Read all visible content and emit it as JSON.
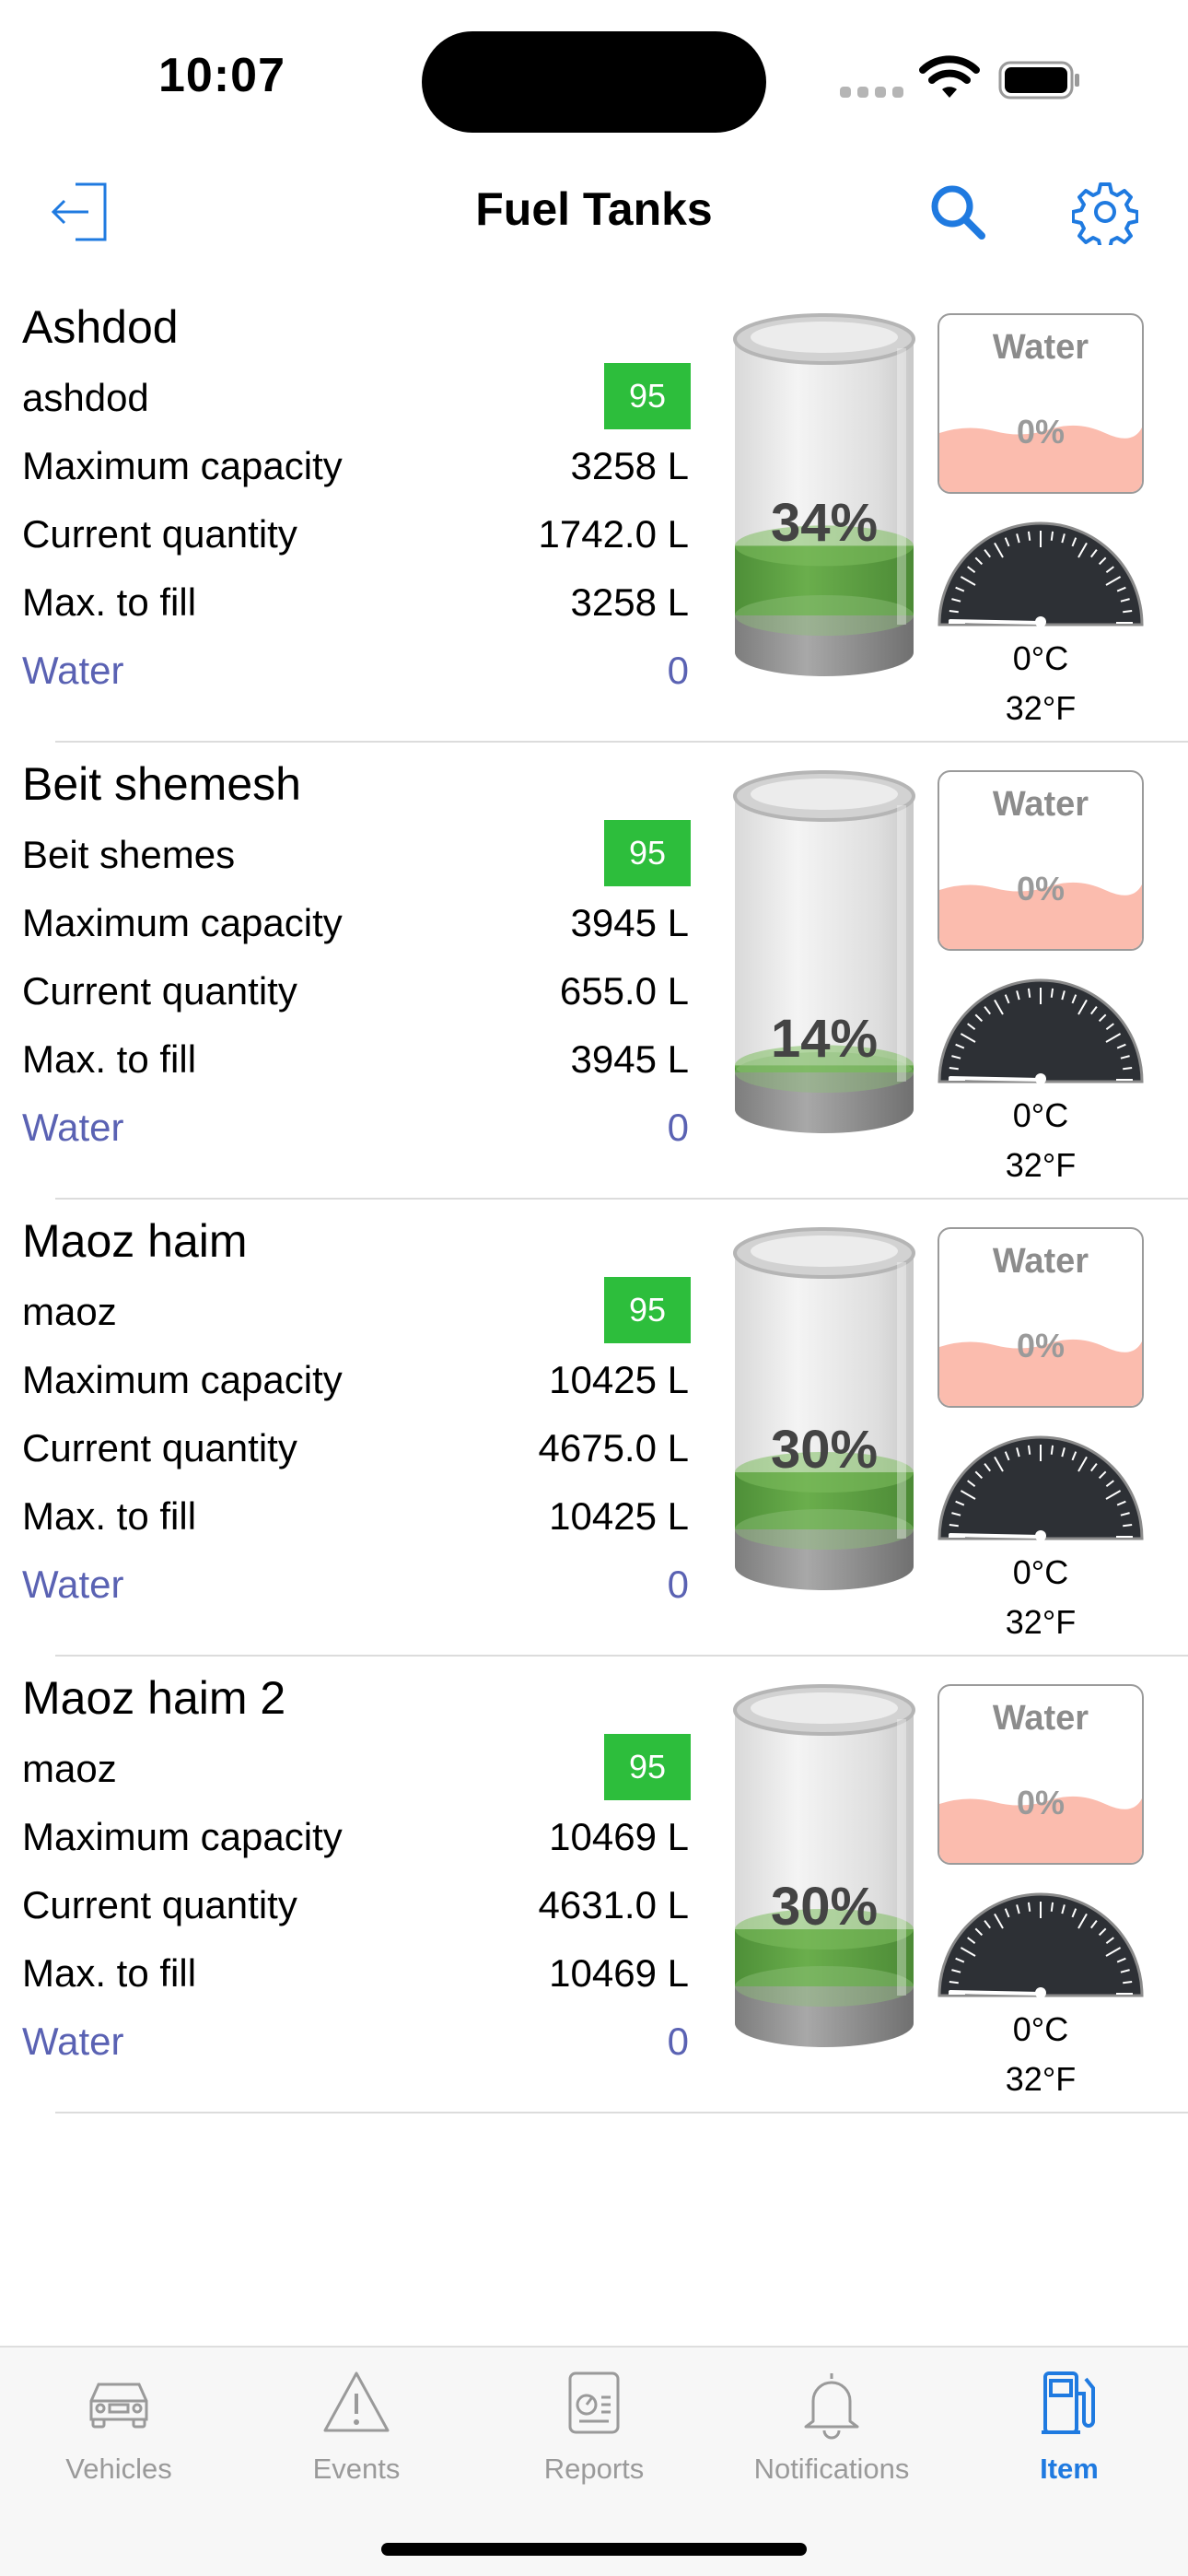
{
  "status": {
    "time": "10:07"
  },
  "nav": {
    "title": "Fuel Tanks"
  },
  "labels": {
    "max_capacity": "Maximum capacity",
    "current_quantity": "Current quantity",
    "max_fill": "Max. to fill",
    "water": "Water"
  },
  "tanks": [
    {
      "name": "Ashdod",
      "sub": "ashdod",
      "fuel": "95",
      "max_capacity": "3258 L",
      "current_quantity": "1742.0 L",
      "max_fill": "3258 L",
      "water_value": "0",
      "fill_pct": "34%",
      "fill_fraction": 0.34,
      "water_box_title": "Water",
      "water_pct": "0%",
      "temp_c": "0°C",
      "temp_f": "32°F"
    },
    {
      "name": "Beit shemesh",
      "sub": "Beit shemes",
      "fuel": "95",
      "max_capacity": "3945 L",
      "current_quantity": "655.0 L",
      "max_fill": "3945 L",
      "water_value": "0",
      "fill_pct": "14%",
      "fill_fraction": 0.14,
      "water_box_title": "Water",
      "water_pct": "0%",
      "temp_c": "0°C",
      "temp_f": "32°F"
    },
    {
      "name": "Maoz haim",
      "sub": "maoz",
      "fuel": "95",
      "max_capacity": "10425 L",
      "current_quantity": "4675.0 L",
      "max_fill": "10425 L",
      "water_value": "0",
      "fill_pct": "30%",
      "fill_fraction": 0.3,
      "water_box_title": "Water",
      "water_pct": "0%",
      "temp_c": "0°C",
      "temp_f": "32°F"
    },
    {
      "name": "Maoz haim 2",
      "sub": "maoz",
      "fuel": "95",
      "max_capacity": "10469 L",
      "current_quantity": "4631.0 L",
      "max_fill": "10469 L",
      "water_value": "0",
      "fill_pct": "30%",
      "fill_fraction": 0.3,
      "water_box_title": "Water",
      "water_pct": "0%",
      "temp_c": "0°C",
      "temp_f": "32°F"
    }
  ],
  "tabs": [
    {
      "label": "Vehicles",
      "icon": "car-icon"
    },
    {
      "label": "Events",
      "icon": "warning-icon"
    },
    {
      "label": "Reports",
      "icon": "report-icon"
    },
    {
      "label": "Notifications",
      "icon": "bell-icon"
    },
    {
      "label": "Item",
      "icon": "fuel-pump-icon"
    }
  ],
  "colors": {
    "accent": "#1f7ae0",
    "badge": "#2dbe3c",
    "fuel_fill": "#5aa040",
    "water_fill": "#fbbcae",
    "water_label": "#5a62b3"
  }
}
